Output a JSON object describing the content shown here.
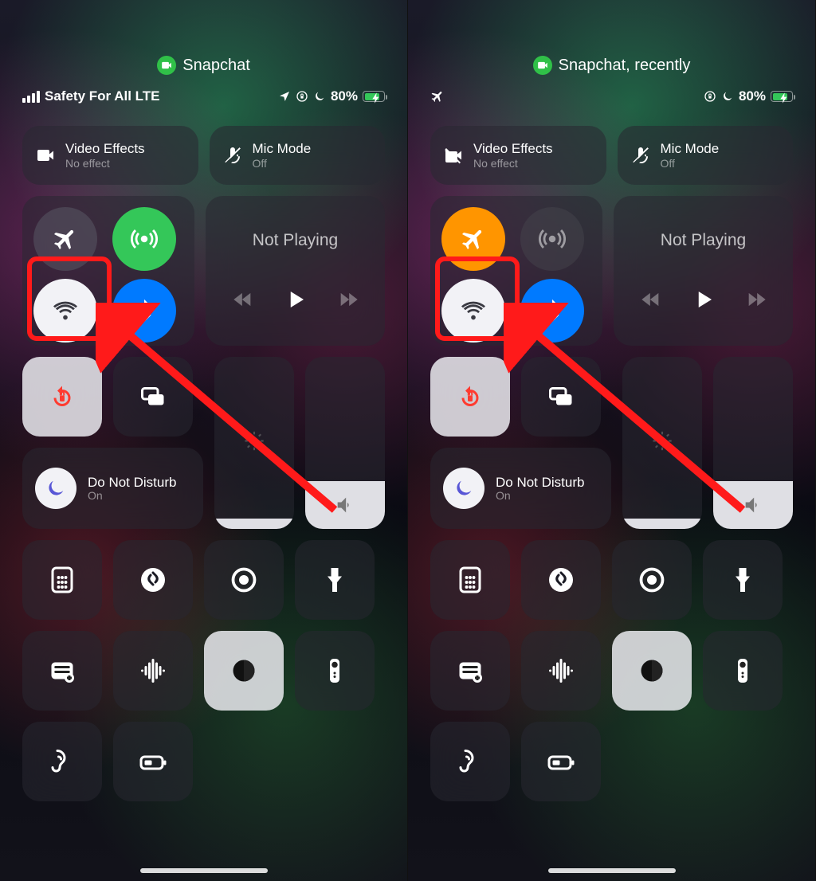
{
  "left": {
    "pill_label": "Snapchat",
    "status": {
      "carrier": "Safety For All LTE",
      "battery_pct": "80%",
      "show_bars": true,
      "airplane": false
    },
    "video_effects": {
      "title": "Video Effects",
      "sub": "No effect"
    },
    "mic_mode": {
      "title": "Mic Mode",
      "sub": "Off"
    },
    "now_playing": "Not Playing",
    "dnd": {
      "title": "Do Not Disturb",
      "sub": "On"
    },
    "airplane_on": false,
    "cellular_on": true,
    "wifi_on": true,
    "bt_on": true
  },
  "right": {
    "pill_label": "Snapchat, recently",
    "status": {
      "carrier": "",
      "battery_pct": "80%",
      "show_bars": false,
      "airplane": true
    },
    "video_effects": {
      "title": "Video Effects",
      "sub": "No effect"
    },
    "mic_mode": {
      "title": "Mic Mode",
      "sub": "Off"
    },
    "now_playing": "Not Playing",
    "dnd": {
      "title": "Do Not Disturb",
      "sub": "On"
    },
    "airplane_on": true,
    "cellular_on": false,
    "wifi_on": true,
    "bt_on": true
  },
  "sliders": {
    "brightness": 6,
    "volume": 28
  }
}
